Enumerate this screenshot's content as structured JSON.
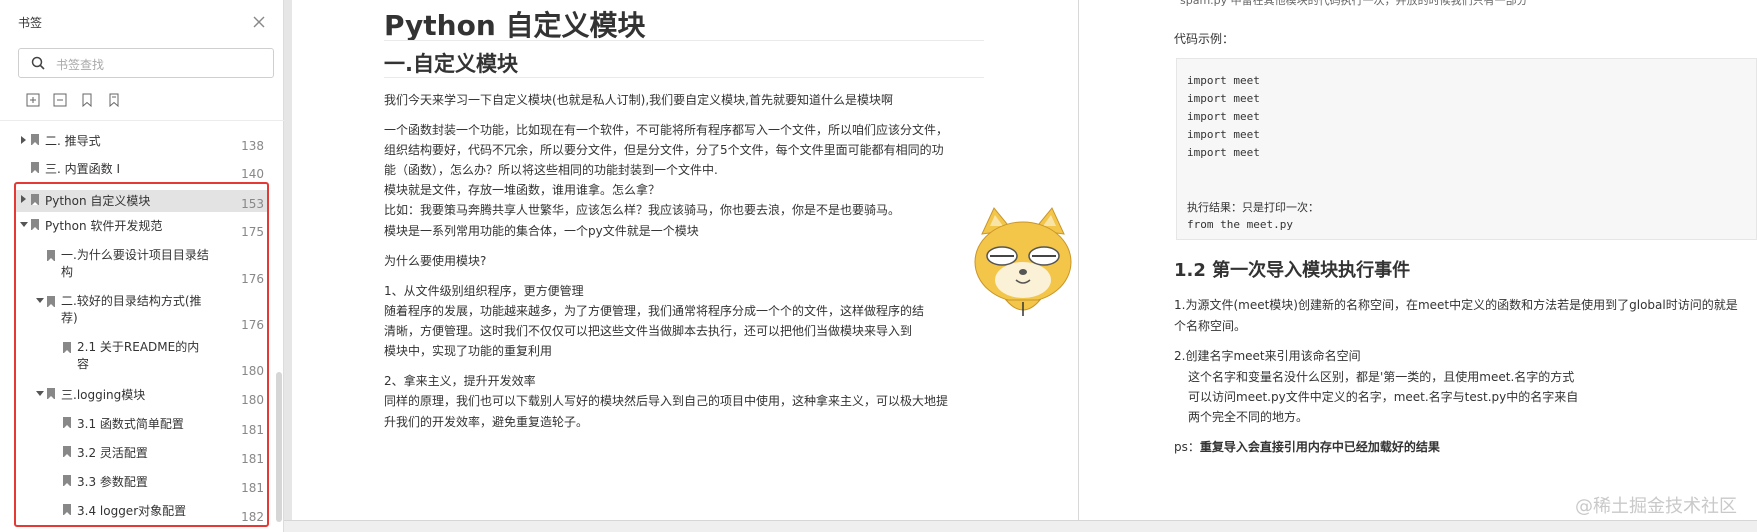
{
  "sidebar": {
    "title": "书签",
    "search_placeholder": "书签查找",
    "toc": [
      {
        "label": "二. 推导式",
        "page": "138"
      },
      {
        "label": "三. 内置函数 I",
        "page": "140"
      },
      {
        "label": "Python 自定义模块",
        "page": "153"
      },
      {
        "label": "Python 软件开发规范",
        "page": "175"
      },
      {
        "label_line1": "一.为什么要设计项目目录结",
        "label_line2": "构",
        "page": "176"
      },
      {
        "label_line1": "二.较好的目录结构方式(推",
        "label_line2": "荐)",
        "page": "176"
      },
      {
        "label_line1": "2.1 关于README的内",
        "label_line2": "容",
        "page": "180"
      },
      {
        "label": "三.logging模块",
        "page": "180"
      },
      {
        "label": "3.1 函数式简单配置",
        "page": "181"
      },
      {
        "label": "3.2 灵活配置",
        "page": "181"
      },
      {
        "label": "3.3 参数配置",
        "page": "181"
      },
      {
        "label": "3.4 logger对象配置",
        "page": "182"
      }
    ]
  },
  "doc": {
    "title": "Python 自定义模块",
    "h2": "一.自定义模块",
    "intro": "我们今天来学习一下自定义模块(也就是私人订制),我们要自定义模块,首先就要知道什么是模块啊",
    "para1": [
      "一个函数封装一个功能，比如现在有一个软件，不可能将所有程序都写入一个文件，所以咱们应该分文件，",
      "组织结构要好，代码不冗余，所以要分文件，但是分文件，分了5个文件，每个文件里面可能都有相同的功",
      "能（函数），怎么办？所以将这些相同的功能封装到一个文件中.",
      "模块就是文件，存放一堆函数，谁用谁拿。怎么拿？",
      "比如：我要策马奔腾共享人世繁华，应该怎么样？我应该骑马，你也要去浪，你是不是也要骑马。",
      "模块是一系列常用功能的集合体，一个py文件就是一个模块"
    ],
    "why": "为什么要使用模块?",
    "point1_title": "1、从文件级别组织程序，更方便管理",
    "point1": [
      "随着程序的发展，功能越来越多，为了方便管理，我们通常将程序分成一个个的文件，这样做程序的结",
      "清晰，方便管理。这时我们不仅仅可以把这些文件当做脚本去执行，还可以把他们当做模块来导入到",
      "模块中，实现了功能的重复利用"
    ],
    "point2_title": "2、拿来主义，提升开发效率",
    "point2": [
      "同样的原理，我们也可以下载别人写好的模块然后导入到自己的项目中使用，这种拿来主义，可以极大地提",
      "升我们的开发效率，避免重复造轮子。"
    ]
  },
  "right": {
    "top_cut": "spam.py 中留在其他模块的代码执行一次，并放的时候我们只有一部分",
    "code_example_label": "代码示例：",
    "code_lines": [
      "import meet",
      "import meet",
      "import meet",
      "import meet",
      "import meet"
    ],
    "result_label": "执行结果：只是打印一次：",
    "result_code": "from the meet.py",
    "h3": "1.2 第一次导入模块执行事件",
    "p1_line1": "1.为源文件(meet模块)创建新的名称空间，在meet中定义的函数和方法若是使用到了global时访问的就是",
    "p1_line2": "个名称空间。",
    "p2_title": "2.创建名字meet来引用该命名空间",
    "p2_lines": [
      "这个名字和变量名没什么区别，都是'第一类的，且使用meet.名字的方式",
      "可以访问meet.py文件中定义的名字，meet.名字与test.py中的名字来自",
      "两个完全不同的地方。"
    ],
    "ps_label": "ps：",
    "ps_bold": "重复导入会直接引用内存中已经加载好的结果",
    "watermark": "@稀土掘金技术社区"
  }
}
